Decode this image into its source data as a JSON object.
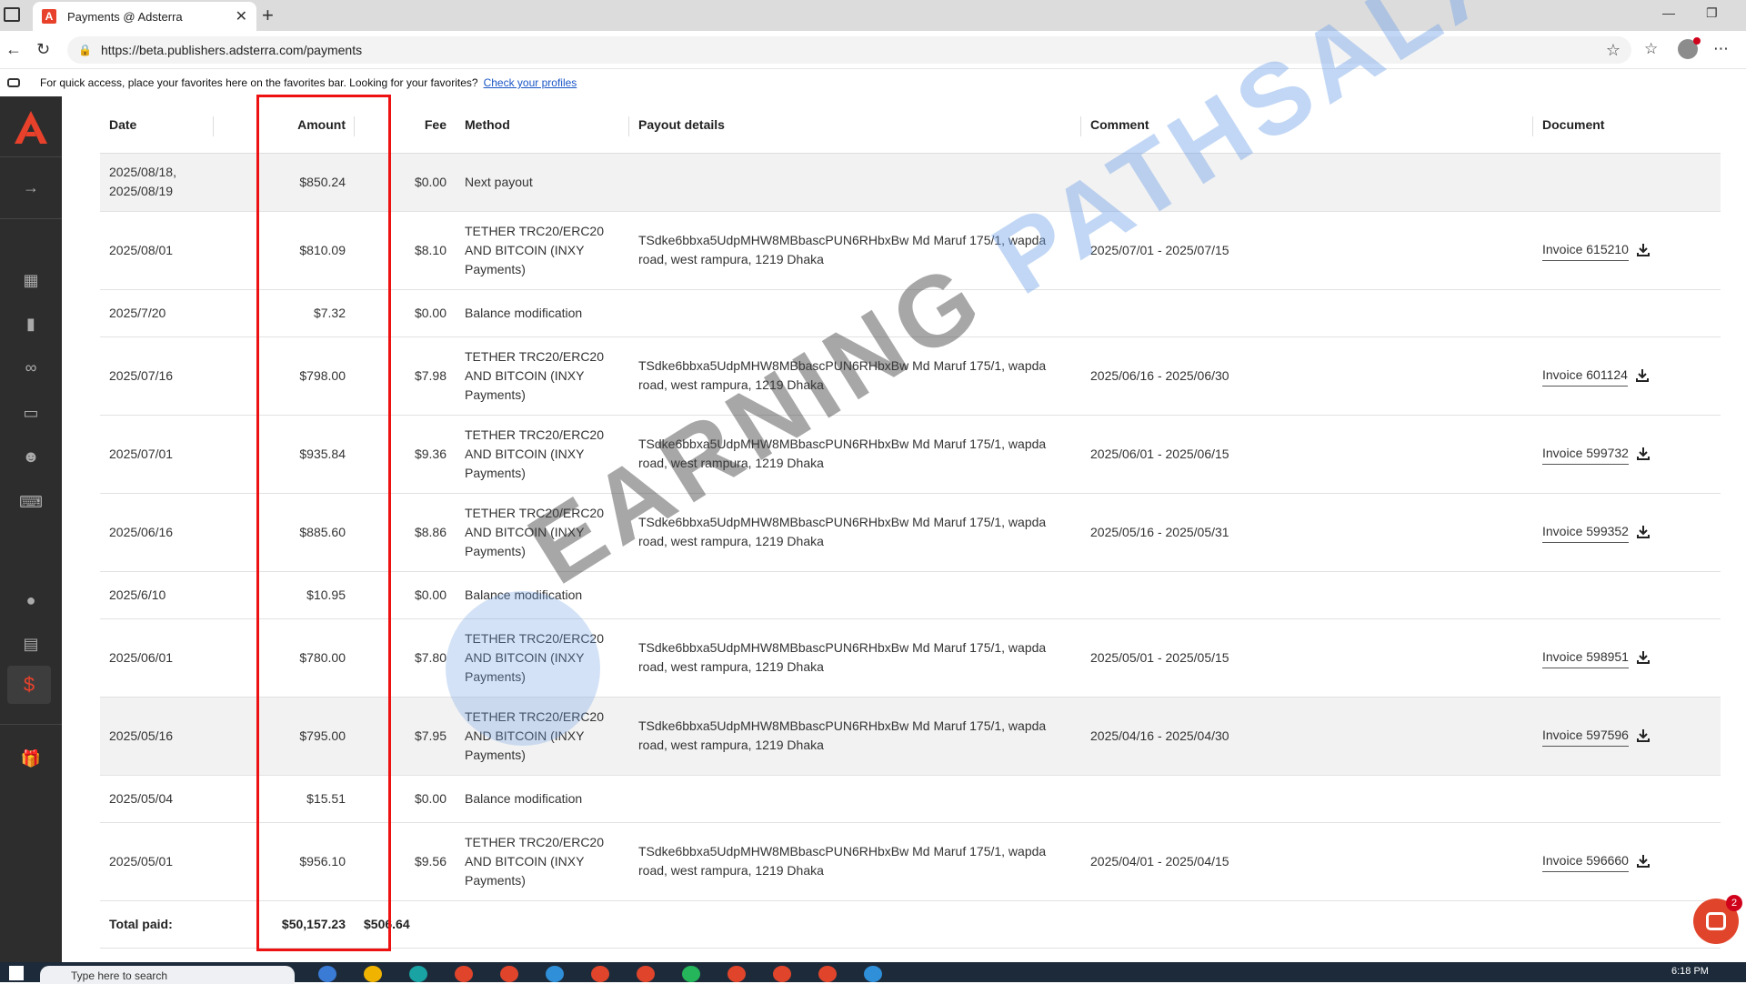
{
  "browser": {
    "tab_title": "Payments @ Adsterra",
    "tab_favicon": "A",
    "url": "https://beta.publishers.adsterra.com/payments",
    "favorites_message": "For quick access, place your favorites here on the favorites bar. Looking for your favorites?",
    "favorites_link": "Check your profiles"
  },
  "sidebar": {
    "brand_color": "#e8412b",
    "items": [
      "expand-arrow-icon",
      "dashboard-icon",
      "statistics-icon",
      "link-icon",
      "monitor-icon",
      "referrals-icon",
      "api-icon",
      "profile-icon",
      "payment-methods-icon",
      "payments-dollar-icon",
      "gift-icon"
    ],
    "active_item": "payments-dollar-icon"
  },
  "table": {
    "headers": {
      "date": "Date",
      "amount": "Amount",
      "fee": "Fee",
      "method": "Method",
      "payout": "Payout details",
      "comment": "Comment",
      "document": "Document"
    },
    "rows": [
      {
        "date": "2025/08/18, 2025/08/19",
        "amount": "$850.24",
        "fee": "$0.00",
        "method": "Next payout",
        "payout": "",
        "comment": "",
        "invoice": ""
      },
      {
        "date": "2025/08/01",
        "amount": "$810.09",
        "fee": "$8.10",
        "method": "TETHER TRC20/ERC20 AND BITCOIN (INXY Payments)",
        "payout": "TSdke6bbxa5UdpMHW8MBbascPUN6RHbxBw Md Maruf 175/1, wapda road, west rampura, 1219 Dhaka",
        "comment": "2025/07/01 - 2025/07/15",
        "invoice": "Invoice 615210"
      },
      {
        "date": "2025/7/20",
        "amount": "$7.32",
        "fee": "$0.00",
        "method": "Balance modification",
        "payout": "",
        "comment": "",
        "invoice": ""
      },
      {
        "date": "2025/07/16",
        "amount": "$798.00",
        "fee": "$7.98",
        "method": "TETHER TRC20/ERC20 AND BITCOIN (INXY Payments)",
        "payout": "TSdke6bbxa5UdpMHW8MBbascPUN6RHbxBw Md Maruf 175/1, wapda road, west rampura, 1219 Dhaka",
        "comment": "2025/06/16 - 2025/06/30",
        "invoice": "Invoice 601124"
      },
      {
        "date": "2025/07/01",
        "amount": "$935.84",
        "fee": "$9.36",
        "method": "TETHER TRC20/ERC20 AND BITCOIN (INXY Payments)",
        "payout": "TSdke6bbxa5UdpMHW8MBbascPUN6RHbxBw Md Maruf 175/1, wapda road, west rampura, 1219 Dhaka",
        "comment": "2025/06/01 - 2025/06/15",
        "invoice": "Invoice 599732"
      },
      {
        "date": "2025/06/16",
        "amount": "$885.60",
        "fee": "$8.86",
        "method": "TETHER TRC20/ERC20 AND BITCOIN (INXY Payments)",
        "payout": "TSdke6bbxa5UdpMHW8MBbascPUN6RHbxBw Md Maruf 175/1, wapda road, west rampura, 1219 Dhaka",
        "comment": "2025/05/16 - 2025/05/31",
        "invoice": "Invoice 599352"
      },
      {
        "date": "2025/6/10",
        "amount": "$10.95",
        "fee": "$0.00",
        "method": "Balance modification",
        "payout": "",
        "comment": "",
        "invoice": ""
      },
      {
        "date": "2025/06/01",
        "amount": "$780.00",
        "fee": "$7.80",
        "method": "TETHER TRC20/ERC20 AND BITCOIN (INXY Payments)",
        "payout": "TSdke6bbxa5UdpMHW8MBbascPUN6RHbxBw Md Maruf 175/1, wapda road, west rampura, 1219 Dhaka",
        "comment": "2025/05/01 - 2025/05/15",
        "invoice": "Invoice 598951"
      },
      {
        "date": "2025/05/16",
        "amount": "$795.00",
        "fee": "$7.95",
        "method": "TETHER TRC20/ERC20 AND BITCOIN (INXY Payments)",
        "payout": "TSdke6bbxa5UdpMHW8MBbascPUN6RHbxBw Md Maruf 175/1, wapda road, west rampura, 1219 Dhaka",
        "comment": "2025/04/16 - 2025/04/30",
        "invoice": "Invoice 597596"
      },
      {
        "date": "2025/05/04",
        "amount": "$15.51",
        "fee": "$0.00",
        "method": "Balance modification",
        "payout": "",
        "comment": "",
        "invoice": ""
      },
      {
        "date": "2025/05/01",
        "amount": "$956.10",
        "fee": "$9.56",
        "method": "TETHER TRC20/ERC20 AND BITCOIN (INXY Payments)",
        "payout": "TSdke6bbxa5UdpMHW8MBbascPUN6RHbxBw Md Maruf 175/1, wapda road, west rampura, 1219 Dhaka",
        "comment": "2025/04/01 - 2025/04/15",
        "invoice": "Invoice 596660"
      }
    ],
    "total": {
      "label": "Total paid:",
      "amount": "$50,157.23",
      "fee": "$506.64"
    }
  },
  "watermark": {
    "part1": "EARNING ",
    "part2": "PATHSALA"
  },
  "chat": {
    "badge": "2"
  },
  "taskbar": {
    "search_placeholder": "Type here to search",
    "time": "6:18 PM"
  }
}
